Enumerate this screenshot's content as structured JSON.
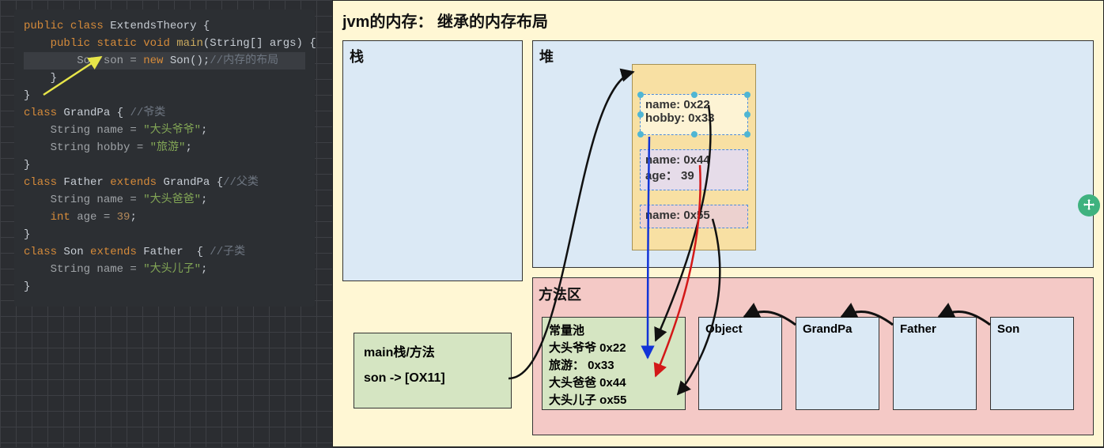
{
  "code": {
    "kw_public": "public",
    "kw_class": "class",
    "kw_static": "static",
    "kw_void": "void",
    "kw_extends": "extends",
    "kw_new": "new",
    "ty_String": "String",
    "ty_int": "int",
    "cls_ExtendsTheory": "ExtendsTheory",
    "m_main": "main",
    "p_args": "(String[] args)",
    "open": " {",
    "close": "}",
    "l3_a": "Son son = ",
    "l3_b": "Son();",
    "l3_cmt": "//内存的布局",
    "cls_GrandPa": "GrandPa",
    "cmt_grandpa": " //爷类",
    "gp_name": "String name = ",
    "gp_name_v": "\"大头爷爷\"",
    "gp_hobby": "String hobby = ",
    "gp_hobby_v": "\"旅游\"",
    "cls_Father": "Father",
    "cmt_father": "//父类",
    "fa_name": "String name = ",
    "fa_name_v": "\"大头爸爸\"",
    "fa_age": "int age = ",
    "fa_age_v": "39",
    "cls_Son": "Son",
    "cmt_son": " //子类",
    "so_name": "String name = ",
    "so_name_v": "\"大头儿子\"",
    "semi": ";"
  },
  "diagram": {
    "title": "jvm的内存：  继承的内存布局",
    "stack_label": "栈",
    "heap_label": "堆",
    "method_label": "方法区",
    "main_frame_title": "main栈/方法",
    "main_frame_ref": "son -> [OX11]",
    "obj_addr": "OX11",
    "sec_grandpa_l1": "name: 0x22",
    "sec_grandpa_l2": "hobby: 0x33",
    "sec_father_l1": "name: 0x44",
    "sec_father_l2": "age：  39",
    "sec_son_l1": "name: 0x55",
    "const_pool_title": "常量池",
    "cp_l1": "大头爷爷  0x22",
    "cp_l2": "旅游：     0x33",
    "cp_l3": "大头爸爸  0x44",
    "cp_l4": "大头儿子  ox55",
    "class_object": "Object",
    "class_grandpa": "GrandPa",
    "class_father": "Father",
    "class_son": "Son"
  }
}
